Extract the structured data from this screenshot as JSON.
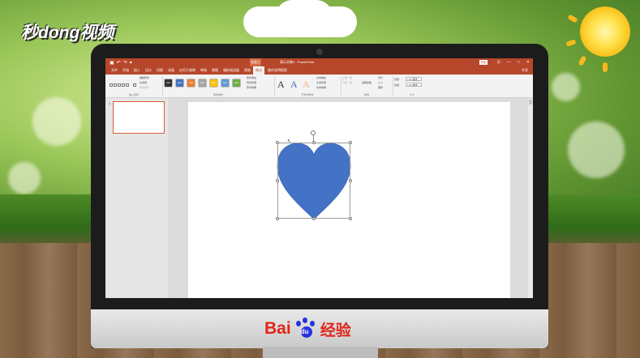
{
  "watermark": {
    "text": "秒dong视频"
  },
  "powerpoint": {
    "quick_access": [
      "▣",
      "↶",
      "↷",
      "▾"
    ],
    "context_tab_group": "绘图工具",
    "doc_title": "演示文稿1 - PowerPoint",
    "login_label": "登录",
    "window_controls": [
      "⊡",
      "—",
      "□",
      "✕"
    ],
    "tabs": [
      {
        "label": "文件",
        "active": false
      },
      {
        "label": "开始",
        "active": false
      },
      {
        "label": "插入",
        "active": false
      },
      {
        "label": "设计",
        "active": false
      },
      {
        "label": "切换",
        "active": false
      },
      {
        "label": "动画",
        "active": false
      },
      {
        "label": "幻灯片放映",
        "active": false
      },
      {
        "label": "审阅",
        "active": false
      },
      {
        "label": "视图",
        "active": false
      },
      {
        "label": "福昕阅读器",
        "active": false
      },
      {
        "label": "帮助",
        "active": false
      },
      {
        "label": "格式",
        "active": true
      }
    ],
    "tell_me": "操作说明搜索",
    "share": "共享",
    "ribbon": {
      "insert_shapes_label": "插入形状",
      "shape_styles_label": "形状样式",
      "wordart_styles_label": "艺术字样式",
      "arrange_label": "排列",
      "size_label": "大小",
      "edit_shape": "编辑形状",
      "text_box": "文本框",
      "merge_shapes": "合并形状",
      "style_swatch_label": "Abc",
      "shape_fill": "形状填充",
      "shape_outline": "形状轮廓",
      "shape_effects": "形状效果",
      "text_fill": "文本填充",
      "text_outline": "文本轮廓",
      "text_effects": "文本效果",
      "wordart_letter": "A",
      "bring_forward": "上移一层",
      "send_backward": "下移一层",
      "selection_pane": "选择窗格",
      "align": "对齐",
      "group": "组合",
      "rotate": "旋转",
      "height_label": "高度:",
      "height_value": "7.41 厘米",
      "width_label": "宽度:",
      "width_value": "7.41 厘米"
    },
    "slide_number": "1"
  },
  "brand": {
    "bai": "Bai",
    "du": "du",
    "jingyan": "经验"
  },
  "colors": {
    "accent": "#b7472a",
    "heart_fill": "#4472c4",
    "swatches": [
      "#333333",
      "#4472c4",
      "#ed7d31",
      "#a5a5a5",
      "#ffc000",
      "#5b9bd5",
      "#70ad47"
    ]
  }
}
